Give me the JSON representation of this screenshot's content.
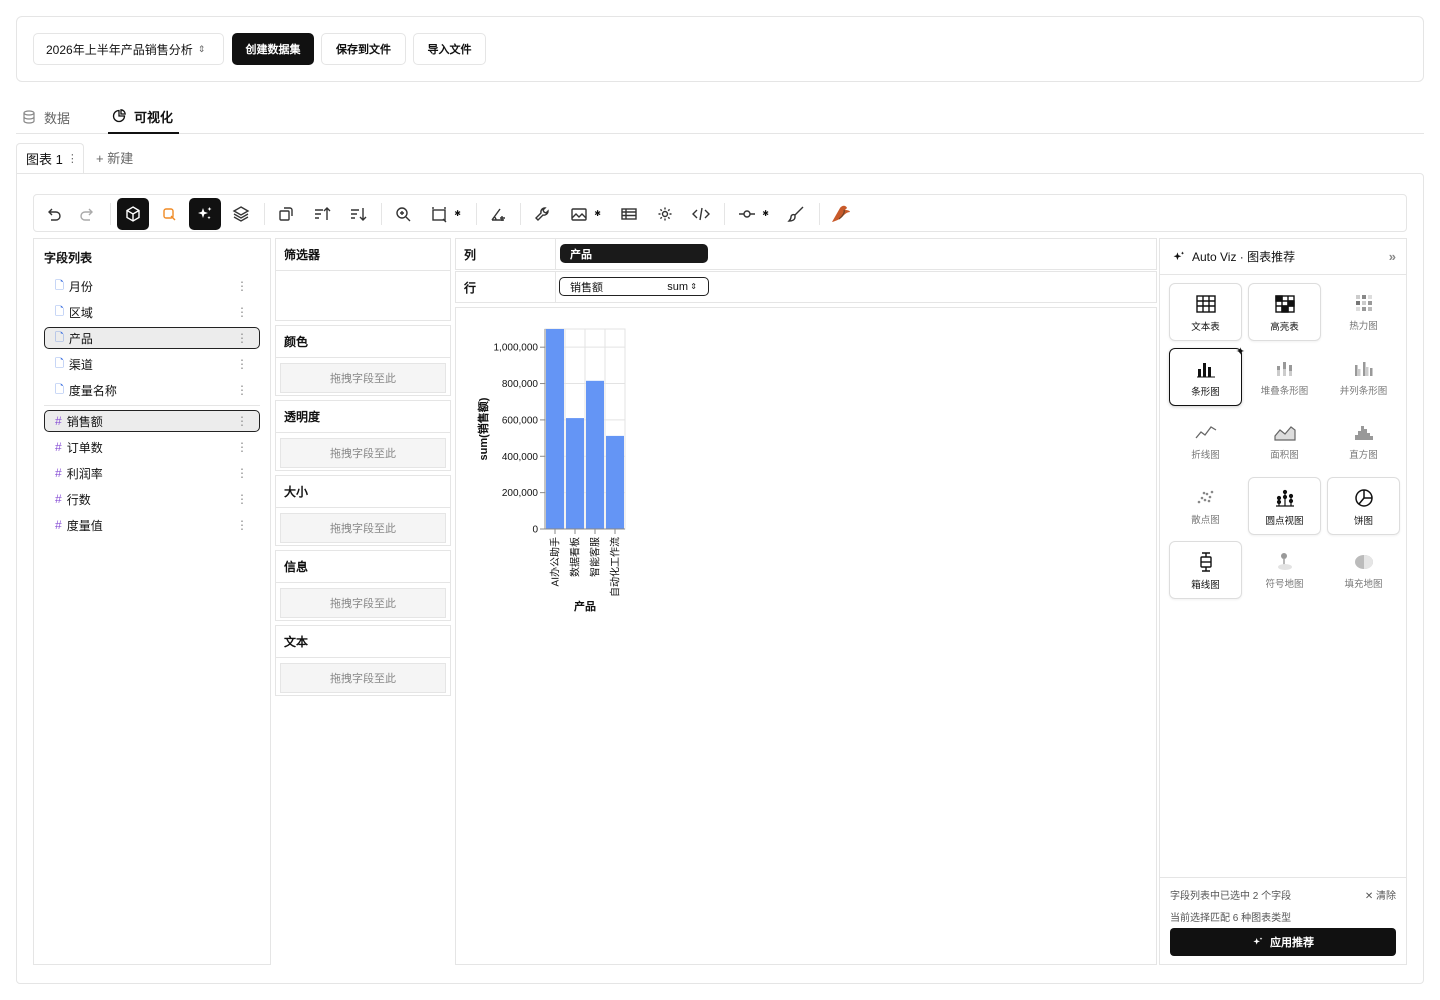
{
  "topbar": {
    "dataset": "2026年上半年产品销售分析",
    "create_label": "创建数据集",
    "save_label": "保存到文件",
    "import_label": "导入文件"
  },
  "tabs": [
    {
      "label": "数据"
    },
    {
      "label": "可视化"
    }
  ],
  "chart_tab": {
    "label": "图表 1",
    "new_label": "+ 新建"
  },
  "fields": {
    "title": "字段列表",
    "dimensions": [
      "月份",
      "区域",
      "产品",
      "渠道",
      "度量名称"
    ],
    "measures": [
      "销售额",
      "订单数",
      "利润率",
      "行数",
      "度量值"
    ]
  },
  "filters": {
    "title": "筛选器"
  },
  "encodings": [
    {
      "label": "颜色",
      "placeholder": "拖拽字段至此"
    },
    {
      "label": "透明度",
      "placeholder": "拖拽字段至此"
    },
    {
      "label": "大小",
      "placeholder": "拖拽字段至此"
    },
    {
      "label": "信息",
      "placeholder": "拖拽字段至此"
    },
    {
      "label": "文本",
      "placeholder": "拖拽字段至此"
    }
  ],
  "shelves": {
    "columns": {
      "label": "列",
      "field": "产品"
    },
    "rows": {
      "label": "行",
      "field": "销售额",
      "agg": "sum"
    }
  },
  "chart_data": {
    "type": "bar",
    "categories": [
      "AI办公助手",
      "数据看板",
      "智能客服",
      "自动化工作流"
    ],
    "values": [
      1100000,
      610000,
      815000,
      512000
    ],
    "xlabel": "产品",
    "ylabel": "sum(销售额)",
    "ylim": [
      0,
      1100000
    ],
    "yticks": [
      0,
      200000,
      400000,
      600000,
      800000,
      1000000
    ],
    "ytick_labels": [
      "0",
      "200,000",
      "400,000",
      "600,000",
      "800,000",
      "1,000,000"
    ],
    "bar_color": "#6495f5",
    "grid": true
  },
  "recommend": {
    "title": "Auto Viz · 图表推荐",
    "charts": [
      {
        "label": "文本表"
      },
      {
        "label": "高亮表"
      },
      {
        "label": "热力图"
      },
      {
        "label": "条形图"
      },
      {
        "label": "堆叠条形图"
      },
      {
        "label": "并列条形图"
      },
      {
        "label": "折线图"
      },
      {
        "label": "面积图"
      },
      {
        "label": "直方图"
      },
      {
        "label": "散点图"
      },
      {
        "label": "圆点视图"
      },
      {
        "label": "饼图"
      },
      {
        "label": "箱线图"
      },
      {
        "label": "符号地图"
      },
      {
        "label": "填充地图"
      }
    ],
    "status1": "字段列表中已选中 2 个字段",
    "clear_label": "清除",
    "status2": "当前选择匹配 6 种图表类型",
    "apply_label": "应用推荐"
  }
}
